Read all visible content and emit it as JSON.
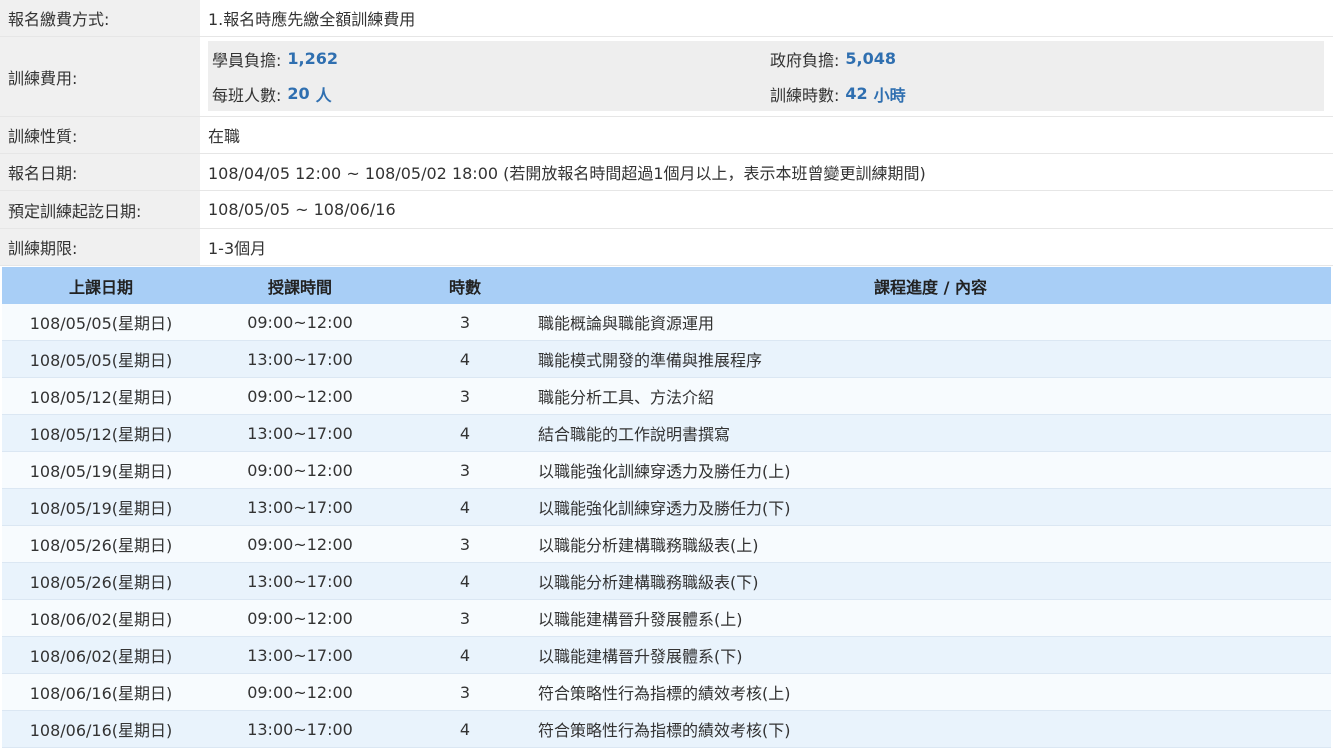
{
  "info": {
    "payment_label": "報名繳費方式:",
    "payment_value": "1.報名時應先繳全額訓練費用",
    "fee_label": "訓練費用:",
    "fee": {
      "student_label": "學員負擔:",
      "student_value": "1,262",
      "gov_label": "政府負擔:",
      "gov_value": "5,048",
      "class_size_label": "每班人數:",
      "class_size_value": "20",
      "class_size_unit": "人",
      "hours_label": "訓練時數:",
      "hours_value": "42",
      "hours_unit": "小時"
    },
    "nature_label": "訓練性質:",
    "nature_value": "在職",
    "signup_label": "報名日期:",
    "signup_value": "108/04/05 12:00 ~ 108/05/02 18:00 (若開放報名時間超過1個月以上，表示本班曾變更訓練期間)",
    "period_label": "預定訓練起訖日期:",
    "period_value": "108/05/05 ~ 108/06/16",
    "duration_label": "訓練期限:",
    "duration_value": "1-3個月"
  },
  "schedule": {
    "headers": {
      "date": "上課日期",
      "time": "授課時間",
      "hours": "時數",
      "content": "課程進度 / 內容"
    },
    "rows": [
      {
        "date": "108/05/05(星期日)",
        "time": "09:00~12:00",
        "hours": "3",
        "content": "職能概論與職能資源運用"
      },
      {
        "date": "108/05/05(星期日)",
        "time": "13:00~17:00",
        "hours": "4",
        "content": "職能模式開發的準備與推展程序"
      },
      {
        "date": "108/05/12(星期日)",
        "time": "09:00~12:00",
        "hours": "3",
        "content": "職能分析工具、方法介紹"
      },
      {
        "date": "108/05/12(星期日)",
        "time": "13:00~17:00",
        "hours": "4",
        "content": "結合職能的工作說明書撰寫"
      },
      {
        "date": "108/05/19(星期日)",
        "time": "09:00~12:00",
        "hours": "3",
        "content": "以職能強化訓練穿透力及勝任力(上)"
      },
      {
        "date": "108/05/19(星期日)",
        "time": "13:00~17:00",
        "hours": "4",
        "content": "以職能強化訓練穿透力及勝任力(下)"
      },
      {
        "date": "108/05/26(星期日)",
        "time": "09:00~12:00",
        "hours": "3",
        "content": "以職能分析建構職務職級表(上)"
      },
      {
        "date": "108/05/26(星期日)",
        "time": "13:00~17:00",
        "hours": "4",
        "content": "以職能分析建構職務職級表(下)"
      },
      {
        "date": "108/06/02(星期日)",
        "time": "09:00~12:00",
        "hours": "3",
        "content": "以職能建構晉升發展體系(上)"
      },
      {
        "date": "108/06/02(星期日)",
        "time": "13:00~17:00",
        "hours": "4",
        "content": "以職能建構晉升發展體系(下)"
      },
      {
        "date": "108/06/16(星期日)",
        "time": "09:00~12:00",
        "hours": "3",
        "content": "符合策略性行為指標的績效考核(上)"
      },
      {
        "date": "108/06/16(星期日)",
        "time": "13:00~17:00",
        "hours": "4",
        "content": "符合策略性行為指標的績效考核(下)"
      }
    ]
  },
  "colors": {
    "header_bg": "#a8cef6",
    "row_odd": "#f7fbfe",
    "row_even": "#e9f3fc",
    "accent_number": "#2f6fb0",
    "label_bg": "#f0f0f0"
  }
}
